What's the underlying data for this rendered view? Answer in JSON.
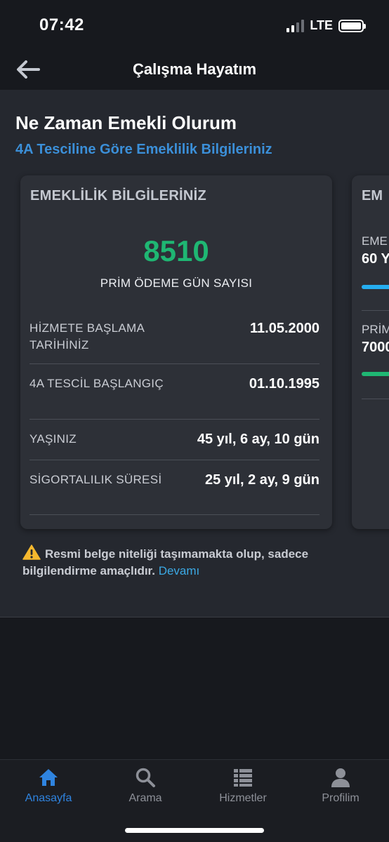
{
  "status_bar": {
    "time": "07:42",
    "network": "LTE"
  },
  "nav": {
    "title": "Çalışma Hayatım"
  },
  "page": {
    "title": "Ne Zaman Emekli Olurum",
    "subtitle": "4A Tesciline Göre Emeklilik Bilgileriniz"
  },
  "card": {
    "title": "EMEKLİLİK BİLGİLERİNİZ",
    "premium_days": "8510",
    "premium_days_label": "PRİM ÖDEME GÜN SAYISI",
    "rows": [
      {
        "label": "HİZMETE BAŞLAMA TARİHİNİZ",
        "value": "11.05.2000"
      },
      {
        "label": "4A TESCİL BAŞLANGIÇ",
        "value": "01.10.1995"
      },
      {
        "label": "YAŞINIZ",
        "value": "45 yıl, 6 ay, 10 gün"
      },
      {
        "label": "SİGORTALILIK SÜRESİ",
        "value": "25 yıl, 2 ay, 9 gün"
      }
    ]
  },
  "next_card": {
    "title": "EM",
    "item1_label": "EME",
    "item1_value": "60 Y",
    "item2_label": "PRİM",
    "item2_value": "7000"
  },
  "warning": {
    "text": "Resmi belge niteliği taşımamakta olup, sadece bilgilendirme amaçlıdır.",
    "link": "Devamı"
  },
  "tabs": [
    {
      "label": "Anasayfa",
      "icon": "home-icon",
      "active": true
    },
    {
      "label": "Arama",
      "icon": "search-icon",
      "active": false
    },
    {
      "label": "Hizmetler",
      "icon": "list-icon",
      "active": false
    },
    {
      "label": "Profilim",
      "icon": "profile-icon",
      "active": false
    }
  ],
  "colors": {
    "accent_blue": "#2f84e0",
    "link_blue": "#3ba9e4",
    "success_green": "#1fb773",
    "warning_yellow": "#f5b82e"
  }
}
